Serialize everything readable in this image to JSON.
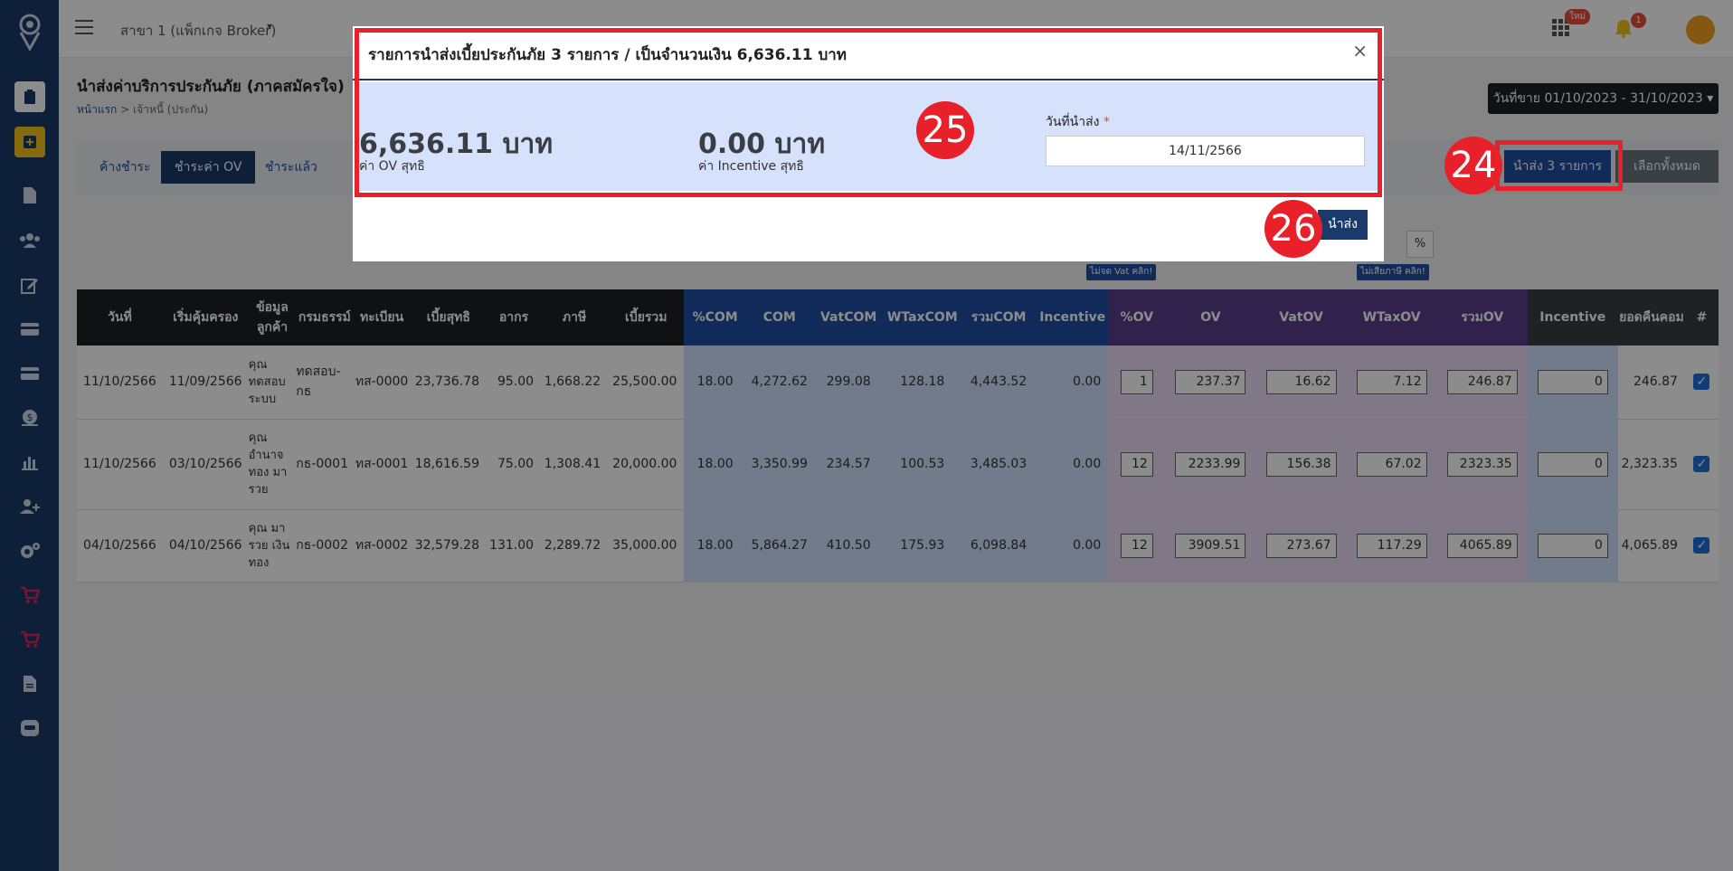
{
  "topbar": {
    "branch": "สาขา 1 (แพ็กเกจ Broker)",
    "new_badge": "ใหม่",
    "notif_count": "1"
  },
  "page": {
    "title": "นำส่งค่าบริการประกันภัย (ภาคสมัครใจ)",
    "breadcrumb_home": "หน้าแรก",
    "breadcrumb_current": "เจ้าหนี้ (ประกัน)",
    "date_range": "วันที่ขาย 01/10/2023 - 31/10/2023"
  },
  "tabs": [
    {
      "label": "ค้างชำระ"
    },
    {
      "label": "ชำระค่า OV"
    },
    {
      "label": "ชำระแล้ว"
    }
  ],
  "actions": {
    "submit_label": "นำส่ง 3 รายการ",
    "select_all_label": "เลือกทั้งหมด",
    "pct_label": "%",
    "no_vat_btn": "ไม่จด Vat คลิก!",
    "no_tax_btn": "ไม่เสียภาษี คลิก!"
  },
  "table": {
    "headers": [
      "วันที่",
      "เริ่มคุ้มครอง",
      "ข้อมูลลูกค้า",
      "กรมธรรม์",
      "ทะเบียน",
      "เบี้ยสุทธิ",
      "อากร",
      "ภาษี",
      "เบี้ยรวม",
      "%COM",
      "COM",
      "VatCOM",
      "WTaxCOM",
      "รวมCOM",
      "Incentive",
      "%OV",
      "OV",
      "VatOV",
      "WTaxOV",
      "รวมOV",
      "Incentive",
      "ยอดคืนคอม",
      "#"
    ],
    "rows": [
      {
        "date": "11/10/2566",
        "start": "11/09/2566",
        "customer": "คุณ ทดสอบ ระบบ",
        "policy": "ทดสอบ-กธ",
        "plate": "ทส-0000",
        "net": "23,736.78",
        "stamp": "95.00",
        "tax": "1,668.22",
        "total": "25,500.00",
        "pct_com": "18.00",
        "com": "4,272.62",
        "vat_com": "299.08",
        "wtax_com": "128.18",
        "sum_com": "4,443.52",
        "incentive": "0.00",
        "pct_ov": "1",
        "ov": "237.37",
        "vat_ov": "16.62",
        "wtax_ov": "7.12",
        "sum_ov": "246.87",
        "incentive_ov": "0",
        "refund": "246.87"
      },
      {
        "date": "11/10/2566",
        "start": "03/10/2566",
        "customer": "คุณ อำนาจ ทอง มา รวย",
        "policy": "กธ-0001",
        "plate": "ทส-0001",
        "net": "18,616.59",
        "stamp": "75.00",
        "tax": "1,308.41",
        "total": "20,000.00",
        "pct_com": "18.00",
        "com": "3,350.99",
        "vat_com": "234.57",
        "wtax_com": "100.53",
        "sum_com": "3,485.03",
        "incentive": "0.00",
        "pct_ov": "12",
        "ov": "2233.99",
        "vat_ov": "156.38",
        "wtax_ov": "67.02",
        "sum_ov": "2323.35",
        "incentive_ov": "0",
        "refund": "2,323.35"
      },
      {
        "date": "04/10/2566",
        "start": "04/10/2566",
        "customer": "คุณ มา รวย เงินทอง",
        "policy": "กธ-0002",
        "plate": "ทส-0002",
        "net": "32,579.28",
        "stamp": "131.00",
        "tax": "2,289.72",
        "total": "35,000.00",
        "pct_com": "18.00",
        "com": "5,864.27",
        "vat_com": "410.50",
        "wtax_com": "175.93",
        "sum_com": "6,098.84",
        "incentive": "0.00",
        "pct_ov": "12",
        "ov": "3909.51",
        "vat_ov": "273.67",
        "wtax_ov": "117.29",
        "sum_ov": "4065.89",
        "incentive_ov": "0",
        "refund": "4,065.89"
      }
    ]
  },
  "modal": {
    "title": "รายการนำส่งเบี้ยประกันภัย 3 รายการ  / เป็นจำนวนเงิน 6,636.11 บาท",
    "close": "×",
    "ov_amount": "6,636.11 บาท",
    "ov_label": "ค่า OV สุทธิ",
    "incentive_amount": "0.00 บาท",
    "incentive_label": "ค่า Incentive สุทธิ",
    "date_label": "วันที่นำส่ง",
    "date_required": "*",
    "date_value": "14/11/2566",
    "submit": "นำส่ง"
  },
  "annotations": {
    "m24": "24",
    "m25": "25",
    "m26": "26"
  },
  "colors": {
    "sidebar": "#1b3a6b",
    "primary": "#1e4fa3",
    "highlight": "#e8202a"
  }
}
